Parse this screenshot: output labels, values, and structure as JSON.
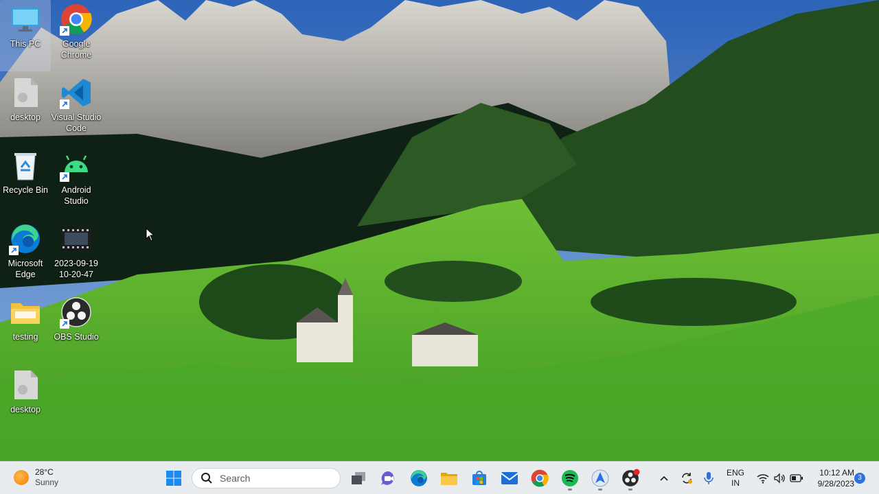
{
  "desktop": {
    "icons": [
      {
        "label": "This PC",
        "icon": "monitor-icon",
        "selected": true
      },
      {
        "label": "Google Chrome",
        "icon": "chrome-icon"
      },
      {
        "label": "desktop",
        "icon": "file-icon"
      },
      {
        "label": "Visual Studio Code",
        "icon": "vscode-icon"
      },
      {
        "label": "Recycle Bin",
        "icon": "recycle-bin-icon"
      },
      {
        "label": "Android Studio",
        "icon": "android-studio-icon"
      },
      {
        "label": "Microsoft Edge",
        "icon": "edge-icon"
      },
      {
        "label": "2023-09-19 10-20-47",
        "icon": "video-file-icon"
      },
      {
        "label": "testing",
        "icon": "folder-icon"
      },
      {
        "label": "OBS Studio",
        "icon": "obs-icon"
      },
      {
        "label": "desktop",
        "icon": "file-icon"
      }
    ]
  },
  "taskbar": {
    "weather": {
      "temp": "28°C",
      "condition": "Sunny",
      "icon": "sun-icon"
    },
    "start_icon": "windows-start-icon",
    "search": {
      "placeholder": "Search",
      "icon": "search-icon"
    },
    "apps": [
      {
        "name": "task-view",
        "icon": "task-view-icon"
      },
      {
        "name": "teams-meet",
        "icon": "teams-icon"
      },
      {
        "name": "microsoft-edge",
        "icon": "edge-icon"
      },
      {
        "name": "file-explorer",
        "icon": "folder-icon"
      },
      {
        "name": "microsoft-store",
        "icon": "store-icon"
      },
      {
        "name": "mail",
        "icon": "mail-icon"
      },
      {
        "name": "google-chrome",
        "icon": "chrome-icon"
      },
      {
        "name": "spotify",
        "icon": "spotify-icon",
        "running": true
      },
      {
        "name": "app-running",
        "icon": "app-icon",
        "running": true
      },
      {
        "name": "obs-studio",
        "icon": "obs-icon",
        "running": true,
        "recording": true
      }
    ],
    "tray": {
      "chevron_icon": "chevron-up-icon",
      "sync_icon": "sync-icon",
      "mic_icon": "microphone-icon",
      "language_line1": "ENG",
      "language_line2": "IN",
      "wifi_icon": "wifi-icon",
      "volume_icon": "volume-icon",
      "battery_icon": "battery-icon"
    },
    "clock": {
      "time": "10:12 AM",
      "date": "9/28/2023"
    },
    "notifications": {
      "count": "3"
    }
  },
  "colors": {
    "taskbar_bg": "#e9ecef",
    "accent": "#2f6fde",
    "recording": "#e0262b"
  }
}
